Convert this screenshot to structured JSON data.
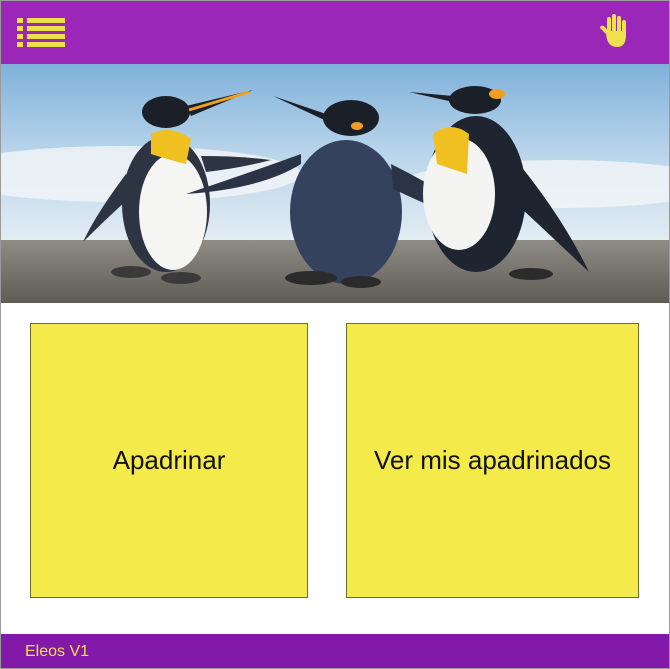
{
  "header": {
    "menu_icon": "menu-list-icon",
    "hand_icon": "raised-hand-icon"
  },
  "hero": {
    "image": "penguins-photo"
  },
  "tiles": [
    {
      "label": "Apadrinar"
    },
    {
      "label": "Ver mis apadrinados"
    }
  ],
  "footer": {
    "version": "Eleos V1"
  },
  "colors": {
    "header_bg": "#9b27b8",
    "footer_bg": "#8319a8",
    "tile_bg": "#f4ea4a",
    "icon": "#f0e050",
    "footer_text": "#f0e050"
  }
}
